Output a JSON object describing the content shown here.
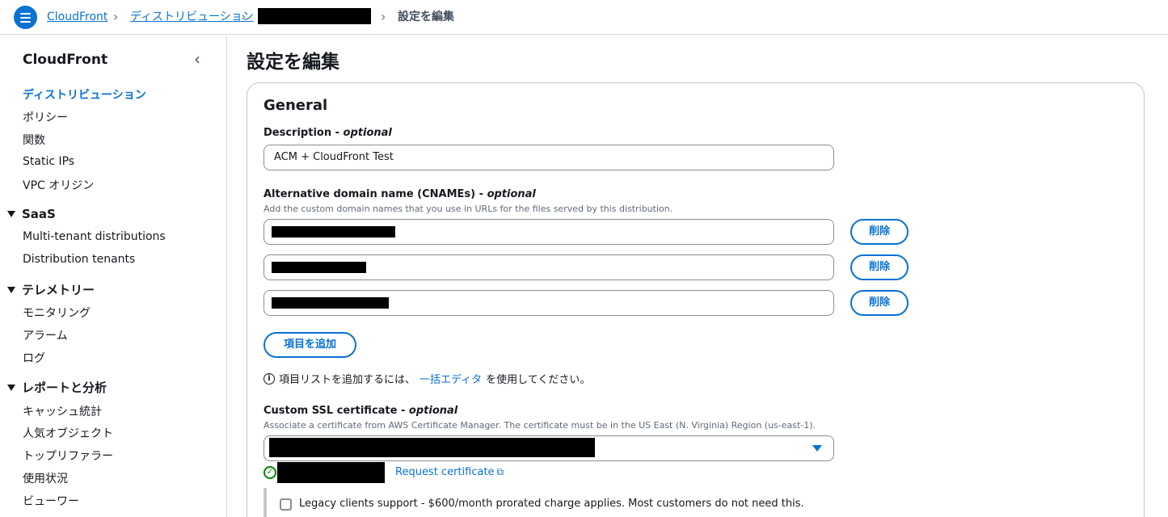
{
  "breadcrumb": {
    "root": "CloudFront",
    "distributions": "ディストリビューション",
    "current": "設定を編集"
  },
  "sidebar": {
    "title": "CloudFront",
    "items": [
      {
        "label": "ディストリビューション",
        "active": true
      },
      {
        "label": "ポリシー"
      },
      {
        "label": "関数"
      },
      {
        "label": "Static IPs"
      },
      {
        "label": "VPC オリジン"
      }
    ],
    "sections": [
      {
        "label": "SaaS",
        "items": [
          "Multi-tenant distributions",
          "Distribution tenants"
        ]
      },
      {
        "label": "テレメトリー",
        "items": [
          "モニタリング",
          "アラーム",
          "ログ"
        ]
      },
      {
        "label": "レポートと分析",
        "items": [
          "キャッシュ統計",
          "人気オブジェクト",
          "トップリファラー",
          "使用状況",
          "ビューワー"
        ]
      }
    ]
  },
  "page": {
    "title": "設定を編集",
    "panel_title": "General"
  },
  "description_field": {
    "label": "Description - ",
    "optional": "optional",
    "value": "ACM + CloudFront Test"
  },
  "cnames_field": {
    "label": "Alternative domain name (CNAMEs) - ",
    "optional": "optional",
    "desc": "Add the custom domain names that you use in URLs for the files served by this distribution.",
    "remove_label": "削除",
    "add_label": "項目を追加"
  },
  "info": {
    "prefix": "項目リストを追加するには、",
    "link": "一括エディタ",
    "suffix": "を使用してください。"
  },
  "ssl_field": {
    "label": "Custom SSL certificate - ",
    "optional": "optional",
    "desc": "Associate a certificate from AWS Certificate Manager. The certificate must be in the US East (N. Virginia) Region (us-east-1).",
    "request_link": "Request certificate"
  },
  "legacy": {
    "label": "Legacy clients support - $600/month prorated charge applies. Most customers do not need this."
  },
  "colors": {
    "accent": "#0972d3",
    "success": "#037f0c"
  }
}
